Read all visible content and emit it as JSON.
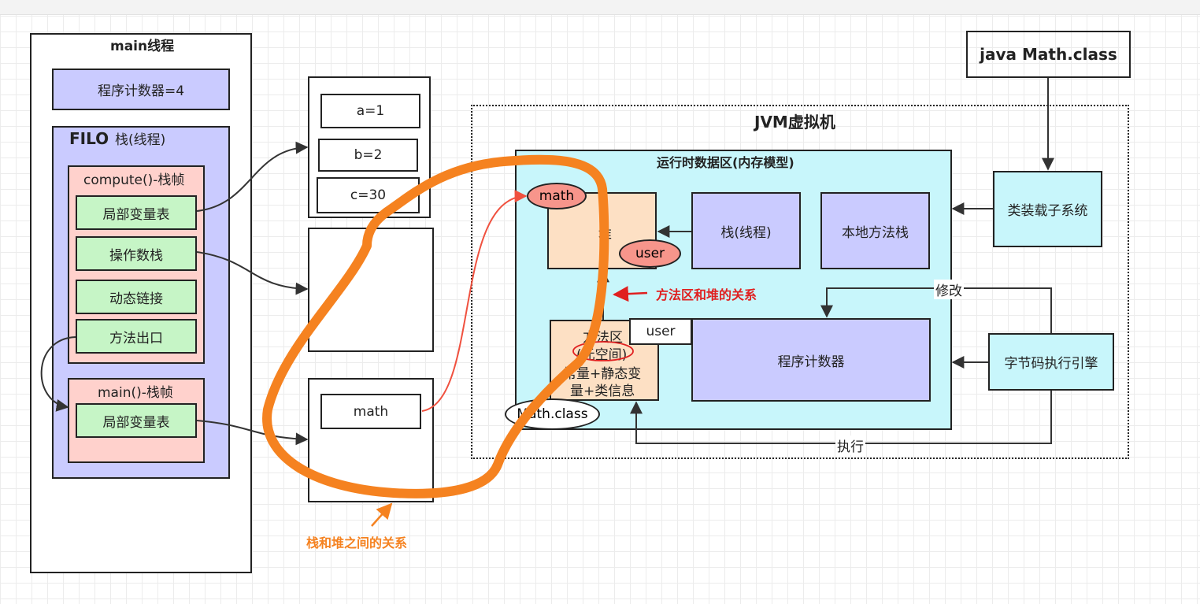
{
  "main_thread": {
    "title": "main线程",
    "program_counter": "程序计数器=4",
    "filo": "FILO",
    "stack_label": "栈(线程)",
    "compute_frame": {
      "title": "compute()-栈帧",
      "items": [
        "局部变量表",
        "操作数栈",
        "动态链接",
        "方法出口"
      ]
    },
    "main_frame": {
      "title": "main()-栈帧",
      "items": [
        "局部变量表"
      ]
    }
  },
  "vars": {
    "a": "a=1",
    "b": "b=2",
    "c": "c=30",
    "math": "math"
  },
  "jvm": {
    "title": "JVM虚拟机",
    "runtime_area": "运行时数据区(内存模型)",
    "heap_label": "堆",
    "heap_math": "math",
    "heap_user": "user",
    "stack_thread": "栈(线程)",
    "native_stack": "本地方法栈",
    "method_area_lines": [
      "方法区",
      "(元空间)",
      "常量+静态变",
      "量+类信息"
    ],
    "method_user": "user",
    "program_counter": "程序计数器",
    "math_class": "Math.class",
    "class_loader": "类装载子系统",
    "exec_engine": "字节码执行引擎",
    "modify": "修改",
    "execute": "执行"
  },
  "top_right": "java Math.class",
  "annotations": {
    "method_heap_relation": "方法区和堆的关系",
    "stack_heap_relation": "栈和堆之间的关系"
  },
  "colors": {
    "green": "#c6f5c6",
    "purple": "#cacbff",
    "pink": "#ffd1cc",
    "cyan": "#c8f6fb",
    "peach": "#fde0c4",
    "salmon": "#f7958b",
    "orange_annotation": "#f58220",
    "red_annotation": "#e02020"
  }
}
